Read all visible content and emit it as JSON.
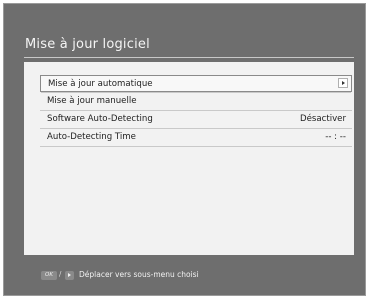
{
  "header": {
    "title": "Mise à jour logiciel"
  },
  "menu": {
    "items": [
      {
        "label": "Mise à jour automatique",
        "value": "",
        "selected": true
      },
      {
        "label": "Mise à jour manuelle",
        "value": "",
        "selected": false
      },
      {
        "label": "Software Auto-Detecting",
        "value": "Désactiver",
        "selected": false
      },
      {
        "label": "Auto-Detecting Time",
        "value": "-- : --",
        "selected": false
      }
    ]
  },
  "footer": {
    "ok_key": "OK",
    "separator": "/",
    "hint": "Déplacer vers sous-menu choisi"
  }
}
